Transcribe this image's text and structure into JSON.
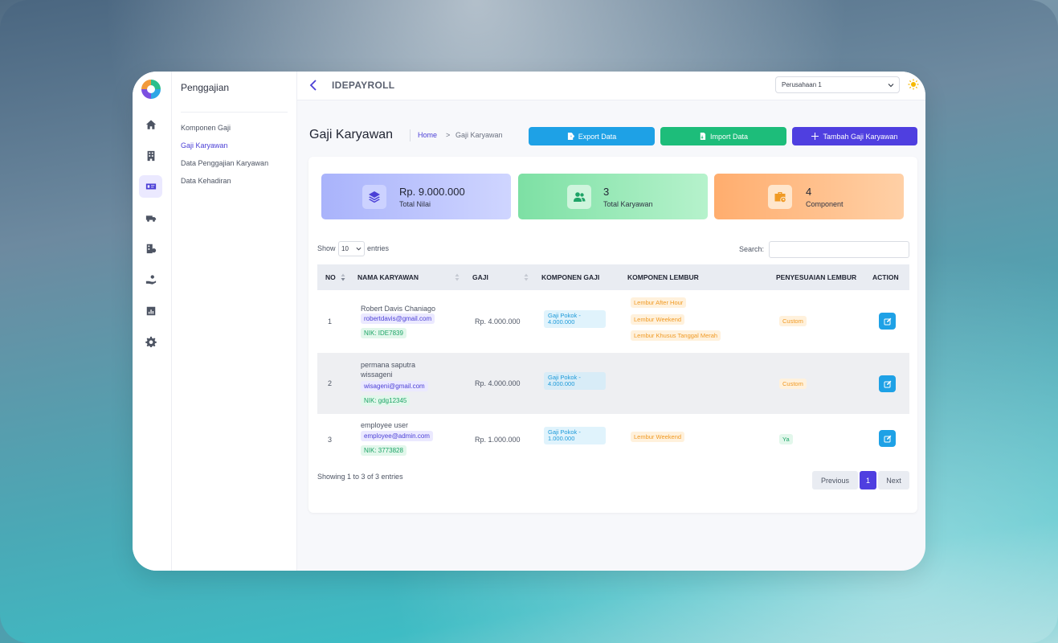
{
  "topbar": {
    "brand": "IDEPAYROLL",
    "company_select": "Perusahaan 1"
  },
  "subnav": {
    "title": "Penggajian",
    "items": [
      {
        "label": "Komponen Gaji"
      },
      {
        "label": "Gaji Karyawan"
      },
      {
        "label": "Data Penggajian Karyawan"
      },
      {
        "label": "Data Kehadiran"
      }
    ]
  },
  "rail": {
    "icons": [
      "home-icon",
      "building-icon",
      "payroll-icon",
      "truck-money-icon",
      "building-money-icon",
      "hand-money-icon",
      "report-chart-icon",
      "gear-icon"
    ]
  },
  "header": {
    "title": "Gaji Karyawan",
    "breadcrumb_home": "Home",
    "breadcrumb_sep": ">",
    "breadcrumb_current": "Gaji Karyawan"
  },
  "buttons": {
    "export": "Export Data",
    "import": "Import Data",
    "add": "Tambah Gaji Karyawan"
  },
  "stats": [
    {
      "value": "Rp. 9.000.000",
      "label": "Total Nilai"
    },
    {
      "value": "3",
      "label": "Total Karyawan"
    },
    {
      "value": "4",
      "label": "Component"
    }
  ],
  "table_controls": {
    "show": "Show",
    "page_size": "10",
    "entries": "entries",
    "search": "Search:"
  },
  "table": {
    "columns": [
      "NO",
      "NAMA KARYAWAN",
      "GAJI",
      "KOMPONEN GAJI",
      "KOMPONEN LEMBUR",
      "PENYESUAIAN LEMBUR",
      "ACTION"
    ],
    "rows": [
      {
        "no": "1",
        "name": "Robert Davis Chaniago",
        "email": "robertdavis@gmail.com",
        "nik": "NIK: IDE7839",
        "gaji": "Rp. 4.000.000",
        "komponen_gaji": "Gaji Pokok - 4.000.000",
        "lembur": [
          "Lembur After Hour",
          "Lembur Weekend",
          "Lembur Khusus Tanggal Merah"
        ],
        "penyesuaian": "Custom"
      },
      {
        "no": "2",
        "name": "permana saputra wissageni",
        "email": "wisageni@gmail.com",
        "nik": "NIK: gdg12345",
        "gaji": "Rp. 4.000.000",
        "komponen_gaji": "Gaji Pokok - 4.000.000",
        "lembur": [],
        "penyesuaian": "Custom"
      },
      {
        "no": "3",
        "name": "employee user",
        "email": "employee@admin.com",
        "nik": "NIK: 3773828",
        "gaji": "Rp. 1.000.000",
        "komponen_gaji": "Gaji Pokok - 1.000.000",
        "lembur": [
          "Lembur Weekend"
        ],
        "penyesuaian": "Ya"
      }
    ]
  },
  "footer": {
    "showing": "Showing 1 to 3 of 3 entries",
    "previous": "Previous",
    "page": "1",
    "next": "Next"
  },
  "colors": {
    "primary": "#4f3fe0",
    "export": "#1ea1e6",
    "import": "#1dbd7a"
  }
}
